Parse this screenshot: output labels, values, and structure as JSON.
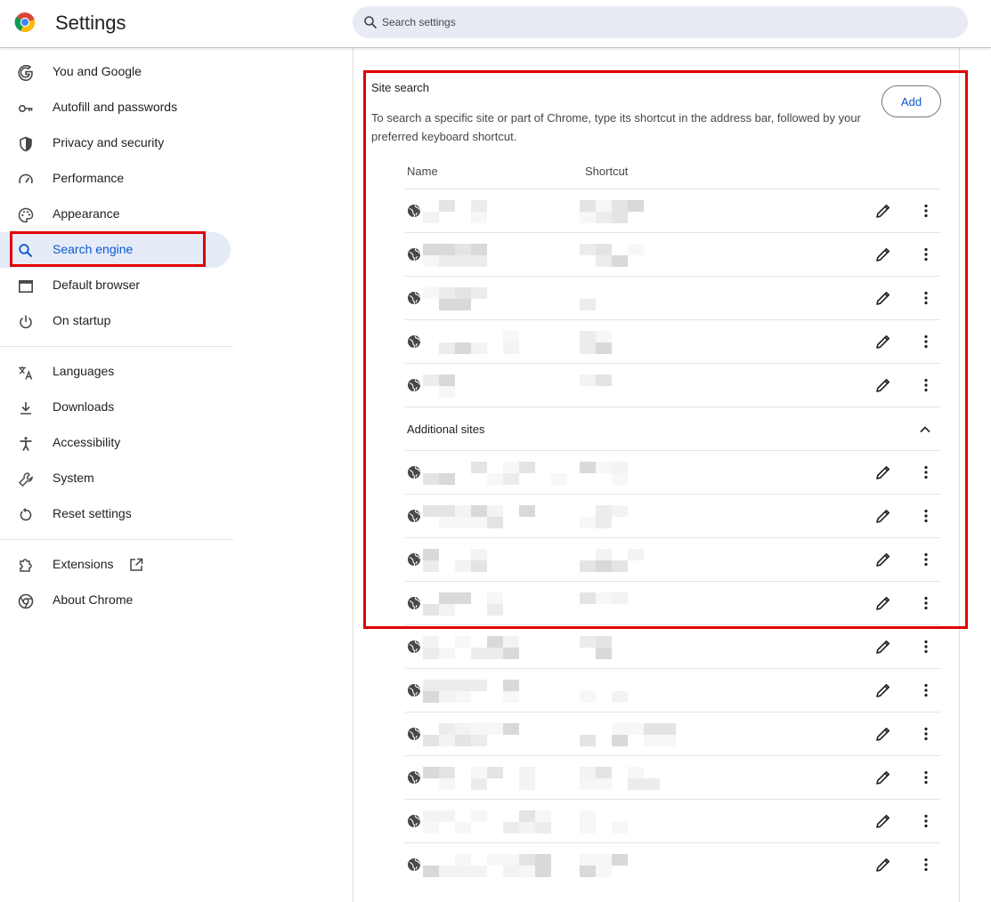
{
  "header": {
    "app_title": "Settings",
    "search_placeholder": "Search settings"
  },
  "sidebar": {
    "items": [
      {
        "label": "You and Google",
        "icon": "google-g-icon"
      },
      {
        "label": "Autofill and passwords",
        "icon": "key-icon"
      },
      {
        "label": "Privacy and security",
        "icon": "shield-icon"
      },
      {
        "label": "Performance",
        "icon": "speedometer-icon"
      },
      {
        "label": "Appearance",
        "icon": "palette-icon"
      },
      {
        "label": "Search engine",
        "icon": "search-icon",
        "active": true
      },
      {
        "label": "Default browser",
        "icon": "browser-window-icon"
      },
      {
        "label": "On startup",
        "icon": "power-icon"
      },
      {
        "label": "Languages",
        "icon": "translate-icon"
      },
      {
        "label": "Downloads",
        "icon": "download-icon"
      },
      {
        "label": "Accessibility",
        "icon": "accessibility-icon"
      },
      {
        "label": "System",
        "icon": "wrench-icon"
      },
      {
        "label": "Reset settings",
        "icon": "reset-icon"
      },
      {
        "label": "Extensions",
        "icon": "puzzle-icon"
      },
      {
        "label": "About Chrome",
        "icon": "chrome-icon"
      }
    ]
  },
  "site_search": {
    "title": "Site search",
    "description": "To search a specific site or part of Chrome, type its shortcut in the address bar, followed by your preferred keyboard shortcut.",
    "add_label": "Add",
    "col_name": "Name",
    "col_shortcut": "Shortcut",
    "additional_label": "Additional sites"
  },
  "colors": {
    "accent": "#0b57d0",
    "active_nav_bg": "#e5ecf8",
    "highlight_box": "#e00000",
    "search_bg": "#e8ebf3"
  }
}
